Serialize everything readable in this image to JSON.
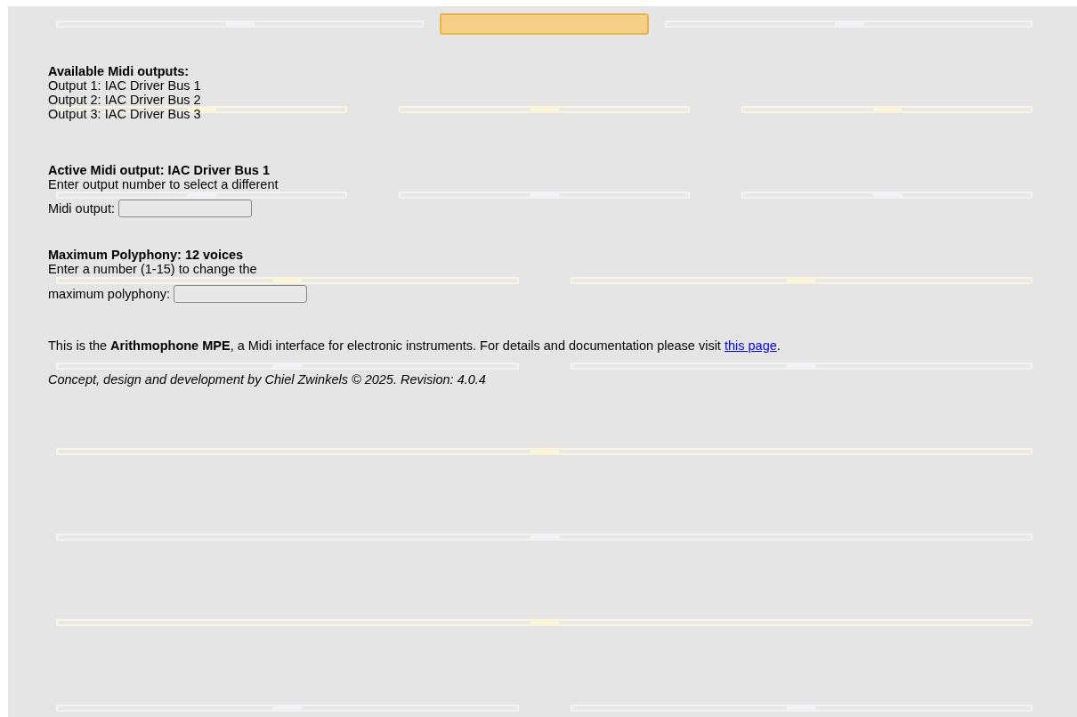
{
  "slider_rows": [
    {
      "items": [
        {
          "kind": "slider",
          "level": 0.5,
          "color": "#f2f2f5"
        },
        {
          "kind": "button",
          "color": "#f5cf85"
        },
        {
          "kind": "slider",
          "level": 0.5,
          "color": "#f2f2f5"
        }
      ]
    },
    {
      "items": [
        {
          "kind": "slider",
          "level": 0.5,
          "color": "#fbf4dc"
        },
        {
          "kind": "slider",
          "level": 0.5,
          "color": "#fbf4dc"
        },
        {
          "kind": "slider",
          "level": 0.5,
          "color": "#fbf4dc"
        }
      ]
    },
    {
      "items": [
        {
          "kind": "slider",
          "level": 0.5,
          "color": "#f2f2f5"
        },
        {
          "kind": "slider",
          "level": 0.5,
          "color": "#f2f2f5"
        },
        {
          "kind": "slider",
          "level": 0.5,
          "color": "#f2f2f5"
        }
      ]
    },
    {
      "items": [
        {
          "kind": "slider",
          "level": 0.5,
          "color": "#fbf4dc"
        },
        {
          "kind": "slider",
          "level": 0.5,
          "color": "#fbf4dc"
        }
      ]
    },
    {
      "items": [
        {
          "kind": "slider",
          "level": 0.5,
          "color": "#f2f2f5"
        },
        {
          "kind": "slider",
          "level": 0.5,
          "color": "#f2f2f5"
        }
      ]
    },
    {
      "items": [
        {
          "kind": "slider",
          "level": 0.5,
          "color": "#fbf4dc"
        }
      ]
    },
    {
      "items": [
        {
          "kind": "slider",
          "level": 0.5,
          "color": "#f2f2f5"
        }
      ]
    },
    {
      "items": [
        {
          "kind": "slider",
          "level": 0.5,
          "color": "#fbf4dc"
        }
      ]
    },
    {
      "items": [
        {
          "kind": "slider",
          "level": 0.5,
          "color": "#f2f2f5"
        },
        {
          "kind": "slider",
          "level": 0.5,
          "color": "#f2f2f5"
        }
      ]
    }
  ],
  "outputs": {
    "heading": "Available Midi outputs:",
    "lines": [
      "Output 1: IAC Driver Bus 1",
      "Output 2: IAC Driver Bus 2",
      "Output 3: IAC Driver Bus 3"
    ]
  },
  "active_output": {
    "heading": "Active Midi output: IAC Driver Bus 1",
    "prompt_line": "Enter output number to select a different",
    "label": "Midi output:"
  },
  "polyphony": {
    "heading": "Maximum Polyphony: 12 voices",
    "prompt_line": "Enter a number (1-15) to change the",
    "label": "maximum polyphony:"
  },
  "about": {
    "text": "This is the **Arithmophone MPE**, a Midi interface for electronic instruments. For details and documentation please visit",
    "link": "this page",
    "after": "."
  },
  "credits": "Concept, design and development by Chiel Zwinkels © 2025. Revision: 4.0.4"
}
